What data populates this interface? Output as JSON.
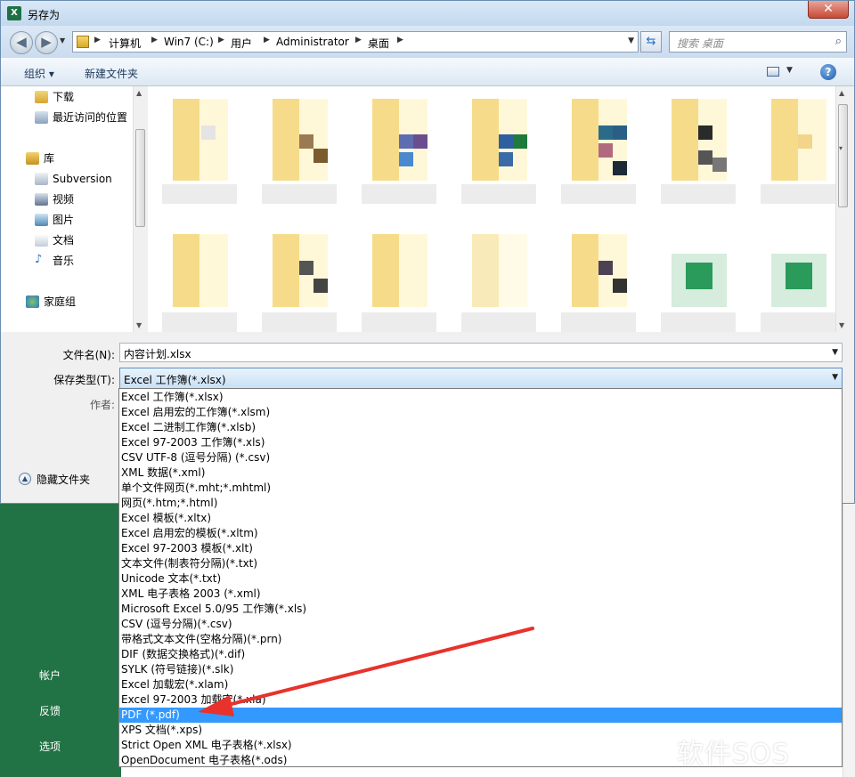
{
  "window": {
    "title": "另存为",
    "app_icon": "excel-icon",
    "close_label": "✕"
  },
  "navigation": {
    "breadcrumbs": [
      "计算机",
      "Win7 (C:)",
      "用户",
      "Administrator",
      "桌面"
    ],
    "search_placeholder": "搜索 桌面"
  },
  "toolbar": {
    "organize_label": "组织 ▾",
    "new_folder_label": "新建文件夹",
    "help_label": "?"
  },
  "nav_pane": {
    "items": [
      "下载",
      "最近访问的位置",
      "库",
      "Subversion",
      "视频",
      "图片",
      "文档",
      "音乐",
      "家庭组"
    ]
  },
  "form": {
    "filename_label": "文件名(N):",
    "filename_value": "内容计划.xlsx",
    "savetype_label": "保存类型(T):",
    "savetype_value": "Excel 工作簿(*.xlsx)",
    "author_label": "作者:",
    "hide_folders_label": "隐藏文件夹"
  },
  "save_types": [
    "Excel 工作簿(*.xlsx)",
    "Excel 启用宏的工作簿(*.xlsm)",
    "Excel 二进制工作簿(*.xlsb)",
    "Excel 97-2003 工作簿(*.xls)",
    "CSV UTF-8 (逗号分隔) (*.csv)",
    "XML 数据(*.xml)",
    "单个文件网页(*.mht;*.mhtml)",
    "网页(*.htm;*.html)",
    "Excel 模板(*.xltx)",
    "Excel 启用宏的模板(*.xltm)",
    "Excel 97-2003 模板(*.xlt)",
    "文本文件(制表符分隔)(*.txt)",
    "Unicode 文本(*.txt)",
    "XML 电子表格 2003 (*.xml)",
    "Microsoft Excel 5.0/95 工作簿(*.xls)",
    "CSV (逗号分隔)(*.csv)",
    "带格式文本文件(空格分隔)(*.prn)",
    "DIF (数据交换格式)(*.dif)",
    "SYLK (符号链接)(*.slk)",
    "Excel 加载宏(*.xlam)",
    "Excel 97-2003 加载宏(*.xla)",
    "PDF (*.pdf)",
    "XPS 文档(*.xps)",
    "Strict Open XML 电子表格(*.xlsx)",
    "OpenDocument 电子表格(*.ods)"
  ],
  "selected_save_type": "PDF (*.pdf)",
  "backstage": {
    "items": [
      "帐户",
      "反馈",
      "选项"
    ]
  },
  "colors": {
    "excel_green": "#217346",
    "selection_blue": "#3399ff",
    "annotation_red": "#e8322b"
  },
  "watermark": "软件SOS"
}
